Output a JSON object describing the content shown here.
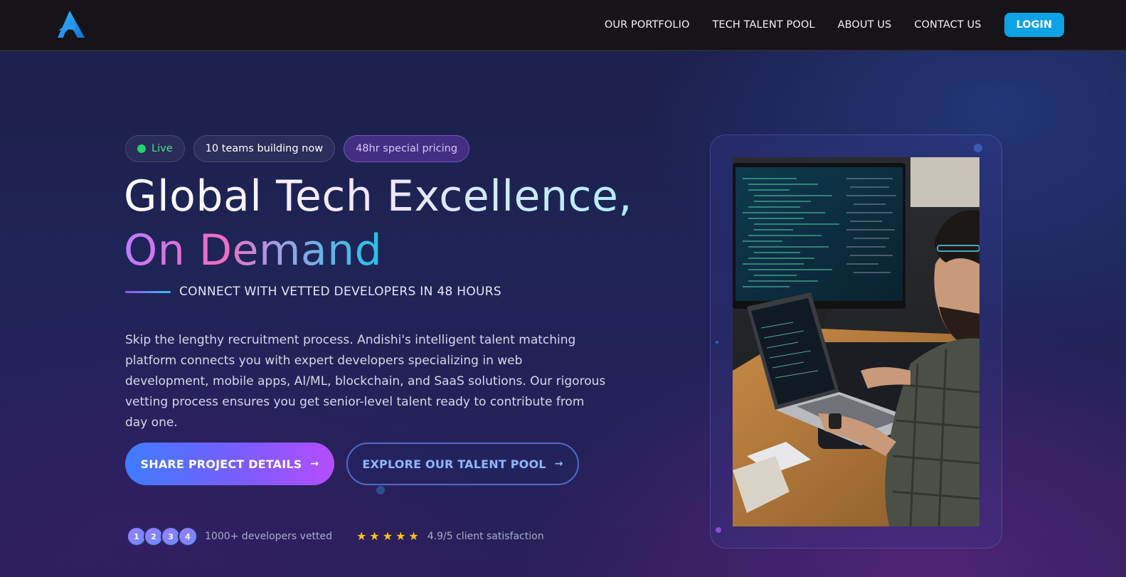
{
  "header": {
    "logo_icon": "andishi-logo-icon",
    "nav": [
      "OUR PORTFOLIO",
      "TECH TALENT POOL",
      "ABOUT US",
      "CONTACT US"
    ],
    "login_label": "LOGIN"
  },
  "badges": {
    "live": "Live",
    "teams": "10 teams building now",
    "pricing": "48hr special pricing"
  },
  "hero": {
    "title_line1": "Global Tech Excellence,",
    "title_line2": "On Demand",
    "subtitle": "CONNECT WITH VETTED DEVELOPERS IN 48 HOURS",
    "description": "Skip the lengthy recruitment process. Andishi's intelligent talent matching platform connects you with expert developers specializing in web development, mobile apps, AI/ML, blockchain, and SaaS solutions. Our rigorous vetting process ensures you get senior-level talent ready to contribute from day one."
  },
  "cta": {
    "primary": "SHARE PROJECT DETAILS",
    "secondary": "EXPLORE OUR TALENT POOL"
  },
  "proof": {
    "avatars": [
      "1",
      "2",
      "3",
      "4"
    ],
    "developers": "1000+ developers vetted",
    "rating_stars": 5,
    "satisfaction": "4.9/5 client satisfaction"
  },
  "colors": {
    "accent_blue": "#0ea2e6",
    "live_green": "#22d36b",
    "star_yellow": "#ffc21a"
  }
}
